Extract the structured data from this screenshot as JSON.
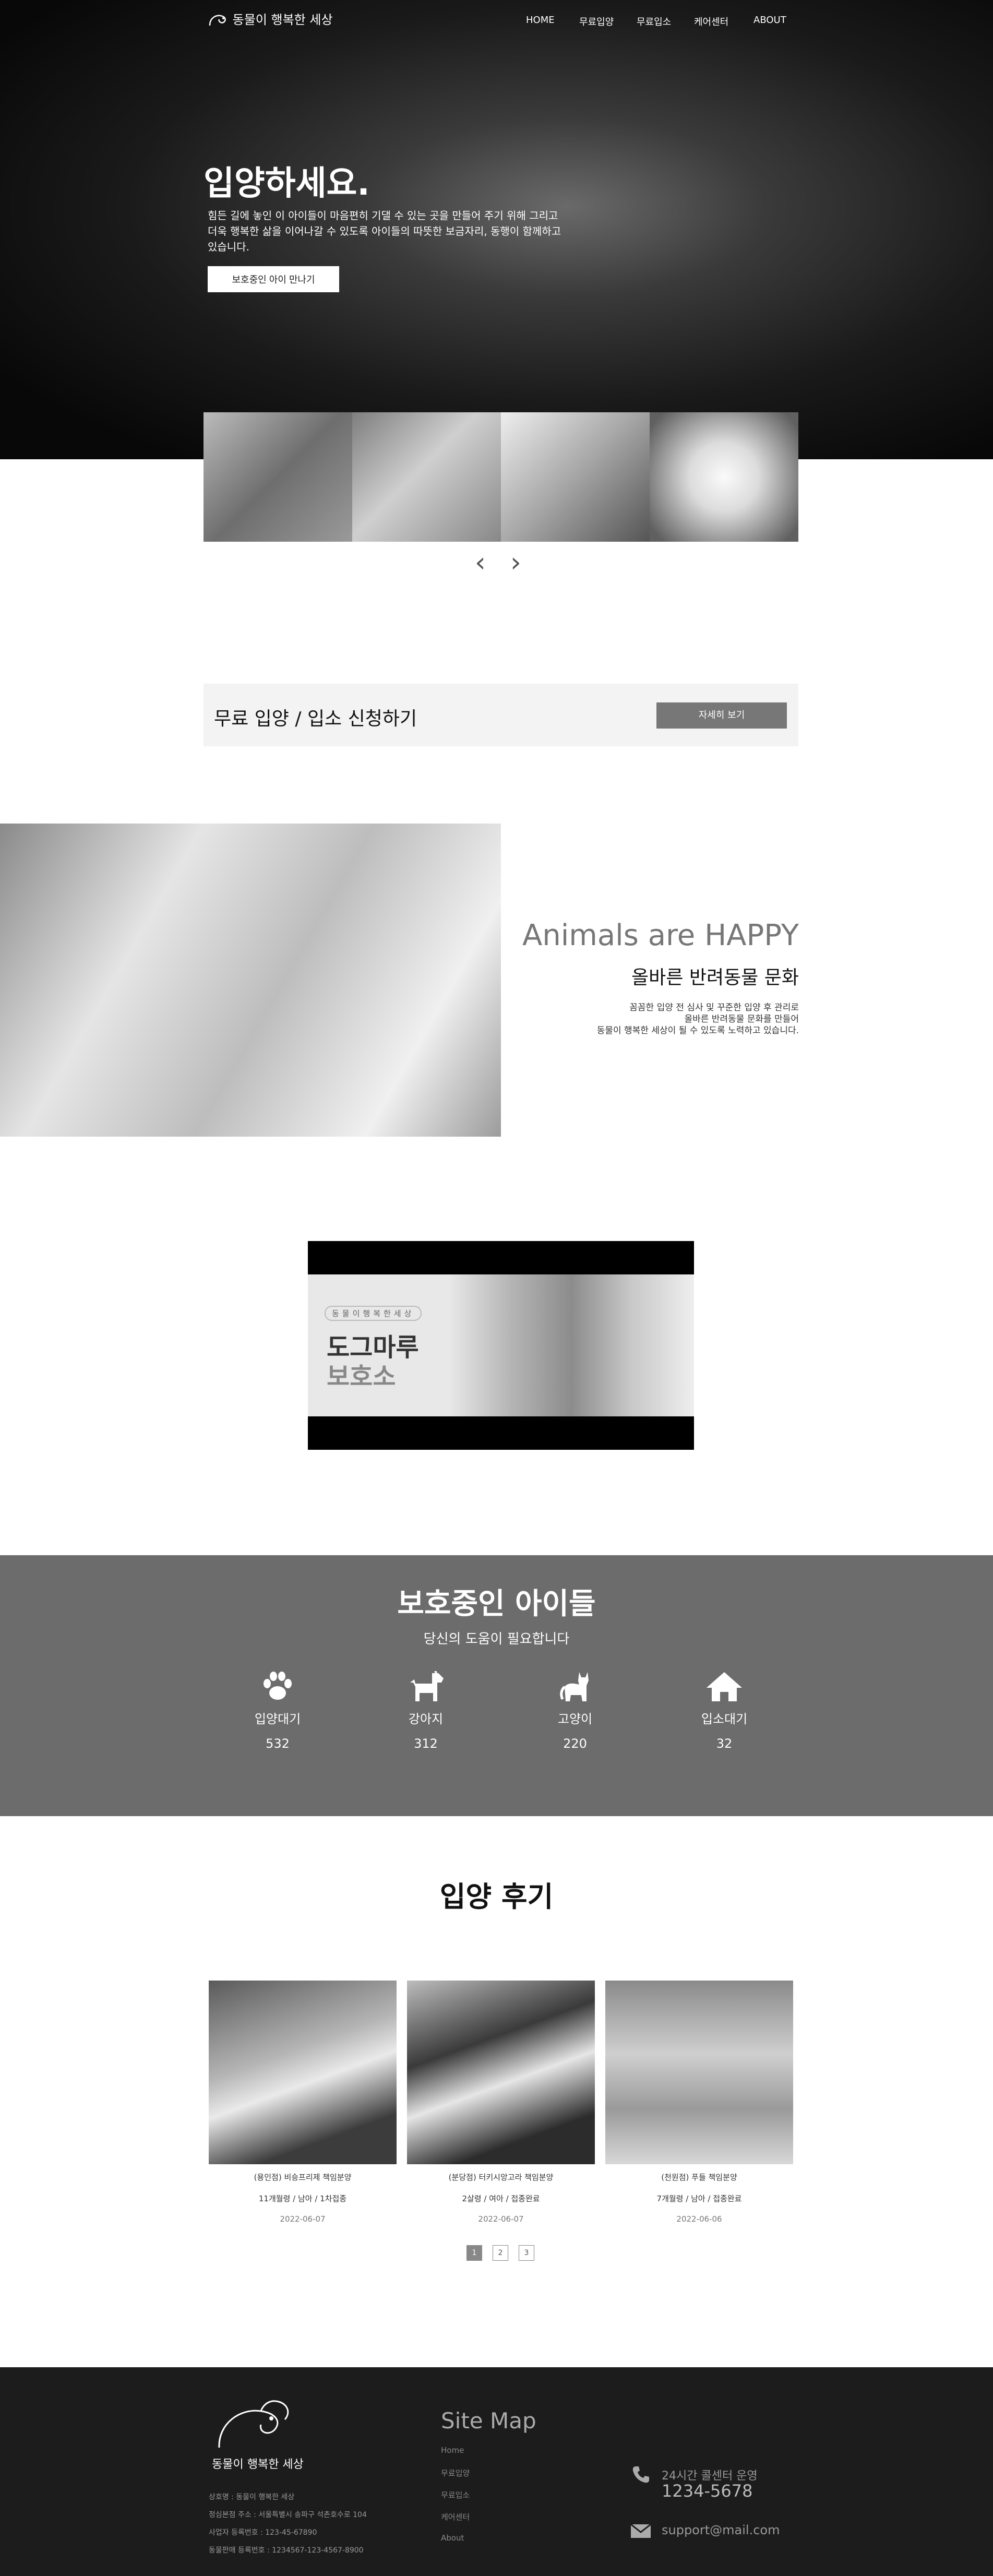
{
  "header": {
    "logo_text": "동물이 행복한 세상",
    "nav": [
      "HOME",
      "무료입양",
      "무료입소",
      "케어센터",
      "ABOUT"
    ]
  },
  "hero": {
    "title": "입양하세요.",
    "desc": "힘든 길에 놓인 이 아이들이 마음편히 기댈 수 있는 곳을 만들어 주기 위해 그리고 더욱 행복한 삶을 이어나갈 수 있도록 아이들의 따뜻한 보금자리, 동행이 함께하고 있습니다.",
    "button": "보호중인 아이 만나기"
  },
  "carousel": {
    "prev": "‹",
    "next": "›"
  },
  "cta": {
    "title": "무료 입양 / 입소 신청하기",
    "button": "자세히 보기"
  },
  "happy": {
    "title": "Animals are HAPPY",
    "subtitle": "올바른 반려동물 문화",
    "desc": [
      "꼼꼼한 입양 전 심사 및 꾸준한 입양 후 관리로",
      "올바른 반려동물 문화를 만들어",
      "동물이 행복한 세상이 될 수 있도록 노력하고 있습니다."
    ]
  },
  "video": {
    "tag": "동물이행복한세상",
    "title1": "도그마루",
    "title2": "보호소"
  },
  "stats": {
    "title": "보호중인 아이들",
    "subtitle": "당신의 도움이 필요합니다",
    "items": [
      {
        "label": "입양대기",
        "value": "532",
        "icon": "paw-icon"
      },
      {
        "label": "강아지",
        "value": "312",
        "icon": "dog-icon"
      },
      {
        "label": "고양이",
        "value": "220",
        "icon": "cat-icon"
      },
      {
        "label": "입소대기",
        "value": "32",
        "icon": "home-icon"
      }
    ]
  },
  "reviews": {
    "title": "입양 후기",
    "cards": [
      {
        "line1": "(용인점) 비숑프리제 책임분양",
        "line2": "11개월령 / 남아 / 1차접종",
        "date": "2022-06-07"
      },
      {
        "line1": "(분당점) 터키시앙고라 책임분양",
        "line2": "2살령 / 여아 / 접종완료",
        "date": "2022-06-07"
      },
      {
        "line1": "(천원점) 푸들 책임분양",
        "line2": "7개월령 / 남아 / 접종완료",
        "date": "2022-06-06"
      }
    ],
    "pages": [
      "1",
      "2",
      "3"
    ]
  },
  "footer": {
    "logo_text": "동물이 행복한 세상",
    "info": [
      "상호명 : 동물이 행복한 세상",
      "정심본점 주소 : 서울특별시 송파구 석촌호수로 104",
      "사업자 등록번호 : 123-45-67890",
      "동물판매 등록번호 : 1234567-123-4567-8900"
    ],
    "sitemap_title": "Site Map",
    "sitemap": [
      "Home",
      "무료입양",
      "무료입소",
      "케어센터",
      "About"
    ],
    "cs_label": "24시간 콜센터 운영",
    "cs_phone": "1234-5678",
    "cs_email": "support@mail.com"
  }
}
